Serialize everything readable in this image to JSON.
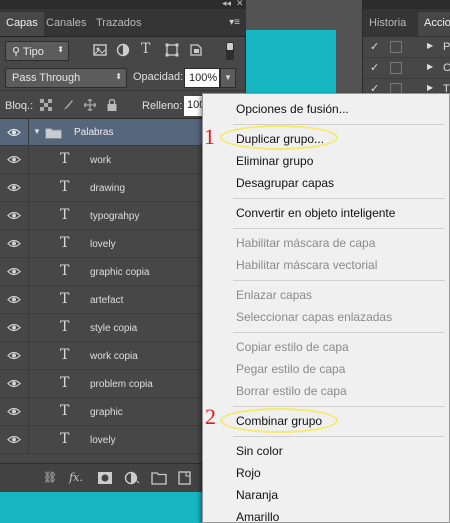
{
  "layers_panel": {
    "tabs": [
      {
        "label": "Capas",
        "active": true
      },
      {
        "label": "Canales",
        "active": false
      },
      {
        "label": "Trazados",
        "active": false
      }
    ],
    "panel_menu_icon": "panel-menu-icon",
    "filter_kind": "Tipo",
    "blend_mode": "Pass Through",
    "opacity_label": "Opacidad:",
    "opacity_value": "100%",
    "lock_label": "Bloq.:",
    "fill_label": "Relleno:",
    "fill_value": "100",
    "group": {
      "name": "Palabras",
      "expanded": true
    },
    "layers": [
      {
        "name": "work"
      },
      {
        "name": "drawing"
      },
      {
        "name": "typograhpy"
      },
      {
        "name": "lovely"
      },
      {
        "name": "graphic copia"
      },
      {
        "name": "artefact"
      },
      {
        "name": "style copia"
      },
      {
        "name": "work copia"
      },
      {
        "name": "problem copia"
      },
      {
        "name": "graphic"
      },
      {
        "name": "lovely"
      }
    ],
    "bottom_icons": [
      "link-icon",
      "fx-icon",
      "mask-icon",
      "adjustment-icon",
      "folder-icon",
      "new-layer-icon",
      "trash-icon"
    ],
    "fx_label": "fx."
  },
  "right_panel": {
    "tabs": [
      {
        "label": "Historia",
        "active": false
      },
      {
        "label": "Accio",
        "active": true
      }
    ],
    "rows": [
      {
        "check": "✓",
        "letter": "P"
      },
      {
        "check": "✓",
        "letter": "C"
      },
      {
        "check": "✓",
        "letter": "T"
      }
    ]
  },
  "context_menu": {
    "items": [
      {
        "label": "Opciones de fusión...",
        "enabled": true
      },
      {
        "label": "Duplicar grupo...",
        "enabled": true
      },
      {
        "label": "Eliminar grupo",
        "enabled": true
      },
      {
        "label": "Desagrupar capas",
        "enabled": true
      },
      {
        "label": "Convertir en objeto inteligente",
        "enabled": true
      },
      {
        "label": "Habilitar máscara de capa",
        "enabled": false
      },
      {
        "label": "Habilitar máscara vectorial",
        "enabled": false
      },
      {
        "label": "Enlazar capas",
        "enabled": false
      },
      {
        "label": "Seleccionar capas enlazadas",
        "enabled": false
      },
      {
        "label": "Copiar estilo de capa",
        "enabled": false
      },
      {
        "label": "Pegar estilo de capa",
        "enabled": false
      },
      {
        "label": "Borrar estilo de capa",
        "enabled": false
      },
      {
        "label": "Combinar grupo",
        "enabled": true
      },
      {
        "label": "Sin color",
        "enabled": true
      },
      {
        "label": "Rojo",
        "enabled": true
      },
      {
        "label": "Naranja",
        "enabled": true
      },
      {
        "label": "Amarillo",
        "enabled": true
      }
    ]
  },
  "annotations": {
    "marker_1": "1",
    "marker_2": "2",
    "highlight_color": "#f5ea6a",
    "marker_color": "#e01b1b"
  },
  "colors": {
    "canvas": "#16b7c3",
    "group_row": "#56667d",
    "panel_bg": "#474747"
  }
}
